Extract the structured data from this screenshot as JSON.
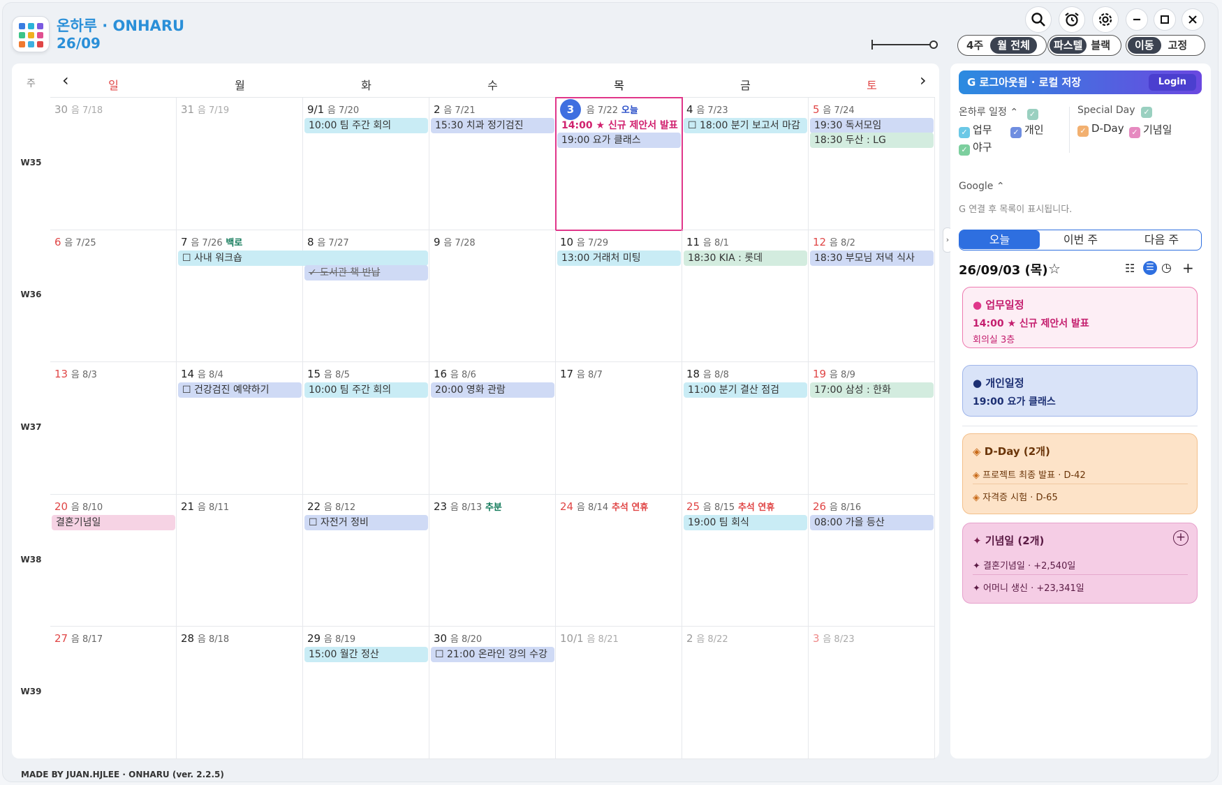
{
  "app": {
    "title": "온하루 · ONHARU",
    "date": "26/09"
  },
  "toolbar": {
    "view_seg": [
      "4주",
      "월 전체"
    ],
    "theme_seg": [
      "파스텔",
      "블랙"
    ],
    "mode_seg": [
      "이동",
      "고정"
    ]
  },
  "calendar": {
    "week_col": "주",
    "days": [
      "일",
      "월",
      "화",
      "수",
      "목",
      "금",
      "토"
    ],
    "weeks": [
      "W35",
      "W36",
      "W37",
      "W38",
      "W39"
    ],
    "colors": {
      "sun": "#e04646",
      "sat": "#e04646",
      "today_border": "#e0368a",
      "holiday": "#127a5a"
    },
    "cells": [
      [
        {
          "d": "30",
          "l": "음 7/18"
        },
        {
          "d": "31",
          "l": "음 7/19"
        },
        {
          "d": "9/1",
          "l": "음 7/20"
        },
        {
          "d": "2",
          "l": "음 7/21"
        },
        {
          "d": "3",
          "l": "음 7/22",
          "h": "오늘"
        },
        {
          "d": "4",
          "l": "음 7/23"
        },
        {
          "d": "5",
          "l": "음 7/24"
        }
      ],
      [
        {
          "d": "6",
          "l": "음 7/25"
        },
        {
          "d": "7",
          "l": "음 7/26",
          "h": "백로"
        },
        {
          "d": "8",
          "l": "음 7/27"
        },
        {
          "d": "9",
          "l": "음 7/28"
        },
        {
          "d": "10",
          "l": "음 7/29"
        },
        {
          "d": "11",
          "l": "음 8/1"
        },
        {
          "d": "12",
          "l": "음 8/2"
        }
      ],
      [
        {
          "d": "13",
          "l": "음 8/3"
        },
        {
          "d": "14",
          "l": "음 8/4"
        },
        {
          "d": "15",
          "l": "음 8/5"
        },
        {
          "d": "16",
          "l": "음 8/6"
        },
        {
          "d": "17",
          "l": "음 8/7"
        },
        {
          "d": "18",
          "l": "음 8/8"
        },
        {
          "d": "19",
          "l": "음 8/9"
        }
      ],
      [
        {
          "d": "20",
          "l": "음 8/10"
        },
        {
          "d": "21",
          "l": "음 8/11"
        },
        {
          "d": "22",
          "l": "음 8/12"
        },
        {
          "d": "23",
          "l": "음 8/13",
          "h": "추분"
        },
        {
          "d": "24",
          "l": "음 8/14",
          "h": "추석 연휴"
        },
        {
          "d": "25",
          "l": "음 8/15",
          "h": "추석 연휴"
        },
        {
          "d": "26",
          "l": "음 8/16"
        }
      ],
      [
        {
          "d": "27",
          "l": "음 8/17"
        },
        {
          "d": "28",
          "l": "음 8/18"
        },
        {
          "d": "29",
          "l": "음 8/19"
        },
        {
          "d": "30",
          "l": "음 8/20"
        },
        {
          "d": "10/1",
          "l": "음 8/21"
        },
        {
          "d": "2",
          "l": "음 8/22"
        },
        {
          "d": "3",
          "l": "음 8/23"
        }
      ]
    ],
    "events": [
      {
        "w": 0,
        "c": 2,
        "r": 0,
        "text": "10:00 팀 주간 회의",
        "color": "cyan"
      },
      {
        "w": 0,
        "c": 3,
        "r": 0,
        "text": "15:30 치과 정기검진",
        "color": "blue"
      },
      {
        "w": 0,
        "c": 4,
        "r": 0,
        "text": "14:00 ★ 신규 제안서 발표",
        "color": "hl"
      },
      {
        "w": 0,
        "c": 4,
        "r": 1,
        "text": "19:00 요가 클래스",
        "color": "blue"
      },
      {
        "w": 0,
        "c": 5,
        "r": 0,
        "text": "☐ 18:00 분기 보고서 마감",
        "color": "cyan"
      },
      {
        "w": 0,
        "c": 6,
        "r": 0,
        "text": "19:30 독서모임",
        "color": "blue"
      },
      {
        "w": 0,
        "c": 6,
        "r": 1,
        "text": "18:30 두산 : LG",
        "color": "green"
      },
      {
        "w": 1,
        "c": 1,
        "r": 0,
        "span": 2,
        "text": "☐ 사내 워크숍",
        "color": "cyan"
      },
      {
        "w": 1,
        "c": 2,
        "r": 1,
        "text": "✓ 도서관 책 반납",
        "color": "blue",
        "strike": true
      },
      {
        "w": 1,
        "c": 4,
        "r": 0,
        "text": "13:00 거래처 미팅",
        "color": "cyan"
      },
      {
        "w": 1,
        "c": 5,
        "r": 0,
        "text": "18:30 KIA : 롯데",
        "color": "green"
      },
      {
        "w": 1,
        "c": 6,
        "r": 0,
        "text": "18:30 부모님 저녁 식사",
        "color": "blue"
      },
      {
        "w": 2,
        "c": 1,
        "r": 0,
        "text": "☐ 건강검진 예약하기",
        "color": "blue"
      },
      {
        "w": 2,
        "c": 2,
        "r": 0,
        "text": "10:00 팀 주간 회의",
        "color": "cyan"
      },
      {
        "w": 2,
        "c": 3,
        "r": 0,
        "text": "20:00 영화 관람",
        "color": "blue"
      },
      {
        "w": 2,
        "c": 5,
        "r": 0,
        "text": "11:00 분기 결산 점검",
        "color": "cyan"
      },
      {
        "w": 2,
        "c": 6,
        "r": 0,
        "text": "17:00 삼성 : 한화",
        "color": "green"
      },
      {
        "w": 3,
        "c": 0,
        "r": 0,
        "text": "결혼기념일",
        "color": "pink"
      },
      {
        "w": 3,
        "c": 2,
        "r": 0,
        "text": "☐ 자전거 정비",
        "color": "blue"
      },
      {
        "w": 3,
        "c": 5,
        "r": 0,
        "text": "19:00 팀 회식",
        "color": "cyan"
      },
      {
        "w": 3,
        "c": 6,
        "r": 0,
        "text": "08:00 가을 등산",
        "color": "blue"
      },
      {
        "w": 4,
        "c": 2,
        "r": 0,
        "text": "15:00 월간 정산",
        "color": "cyan"
      },
      {
        "w": 4,
        "c": 3,
        "r": 0,
        "text": "☐ 21:00 온라인 강의 수강",
        "color": "blue"
      }
    ]
  },
  "side": {
    "google_bar": "G  로그아웃됨 · 로컬 저장",
    "login": "Login",
    "onharu_label": "온하루 일정",
    "special_label": "Special Day",
    "cats": [
      "업무",
      "개인",
      "야구"
    ],
    "specials": [
      "D-Day",
      "기념일"
    ],
    "google_label": "Google",
    "google_note": "G 연결 후 목록이 표시됩니다.",
    "tabs": [
      "오늘",
      "이번 주",
      "다음 주"
    ],
    "selected_date": "26/09/03 (목)",
    "work": {
      "title": "업무일정",
      "item": "14:00 ★ 신규 제안서 발표",
      "sub": "회의실 3층"
    },
    "personal": {
      "title": "개인일정",
      "item": "19:00 요가 클래스"
    },
    "dday": {
      "title": "D-Day (2개)",
      "items": [
        "프로젝트 최종 발표 · D-42",
        "자격증 시험 · D-65"
      ]
    },
    "anniv": {
      "title": "기념일 (2개)",
      "items": [
        "결혼기념일 · +2,540일",
        "어머니 생신 · +23,341일"
      ]
    }
  },
  "footer": "MADE BY JUAN.HJLEE · ONHARU (ver. 2.2.5)"
}
